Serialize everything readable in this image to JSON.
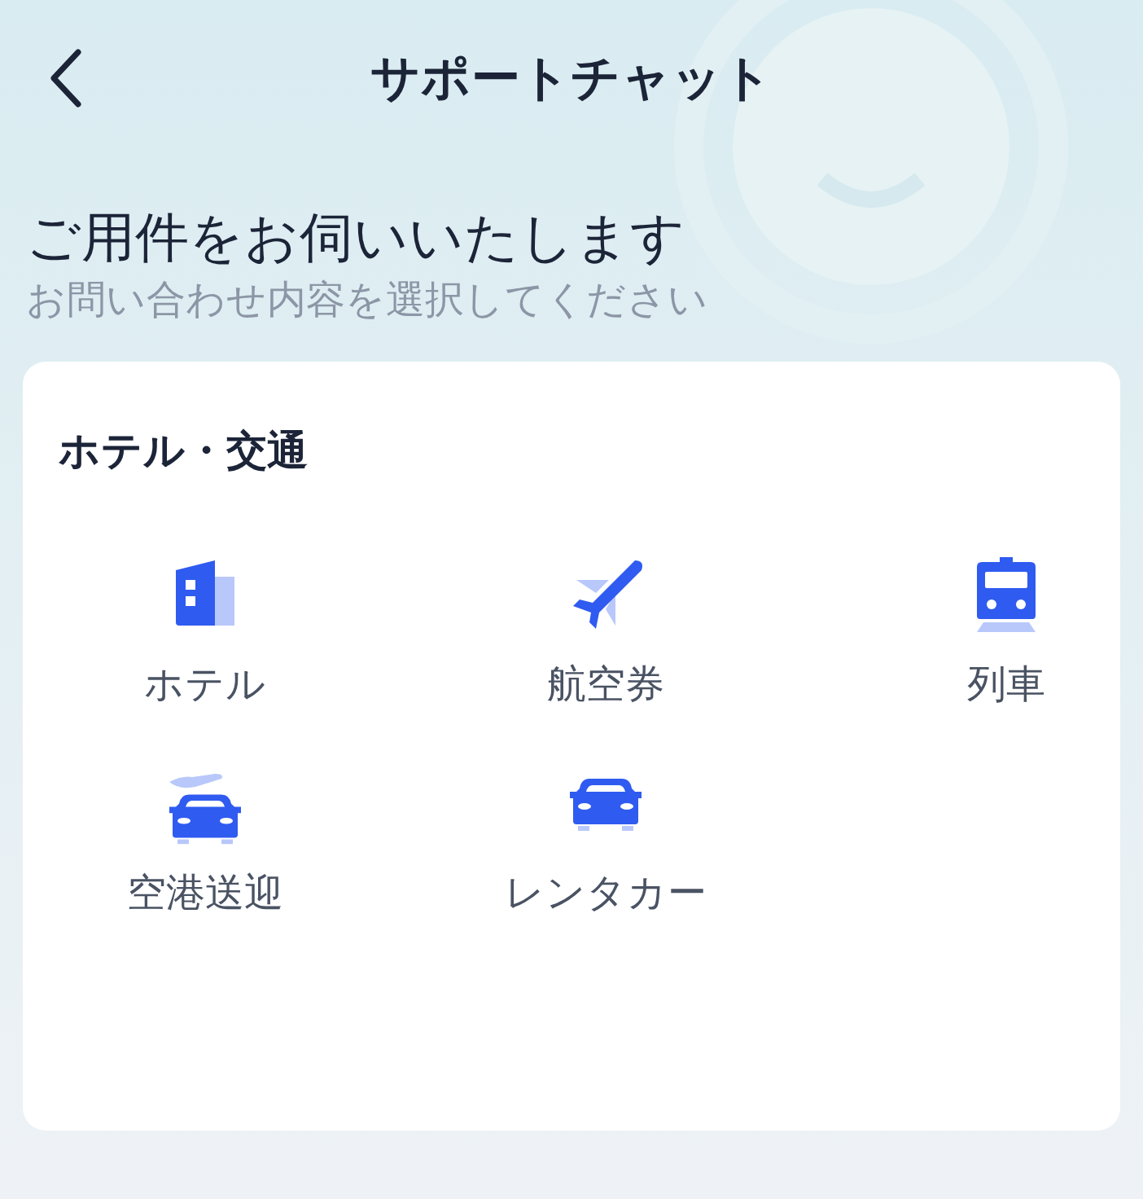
{
  "header": {
    "title": "サポートチャット"
  },
  "intro": {
    "heading": "ご用件をお伺いいたします",
    "subheading": "お問い合わせ内容を選択してください"
  },
  "section": {
    "title": "ホテル・交通",
    "items": [
      {
        "kind": "hotel",
        "label": "ホテル"
      },
      {
        "kind": "flight",
        "label": "航空券"
      },
      {
        "kind": "train",
        "label": "列車"
      },
      {
        "kind": "transfer",
        "label": "空港送迎"
      },
      {
        "kind": "car",
        "label": "レンタカー"
      }
    ]
  }
}
